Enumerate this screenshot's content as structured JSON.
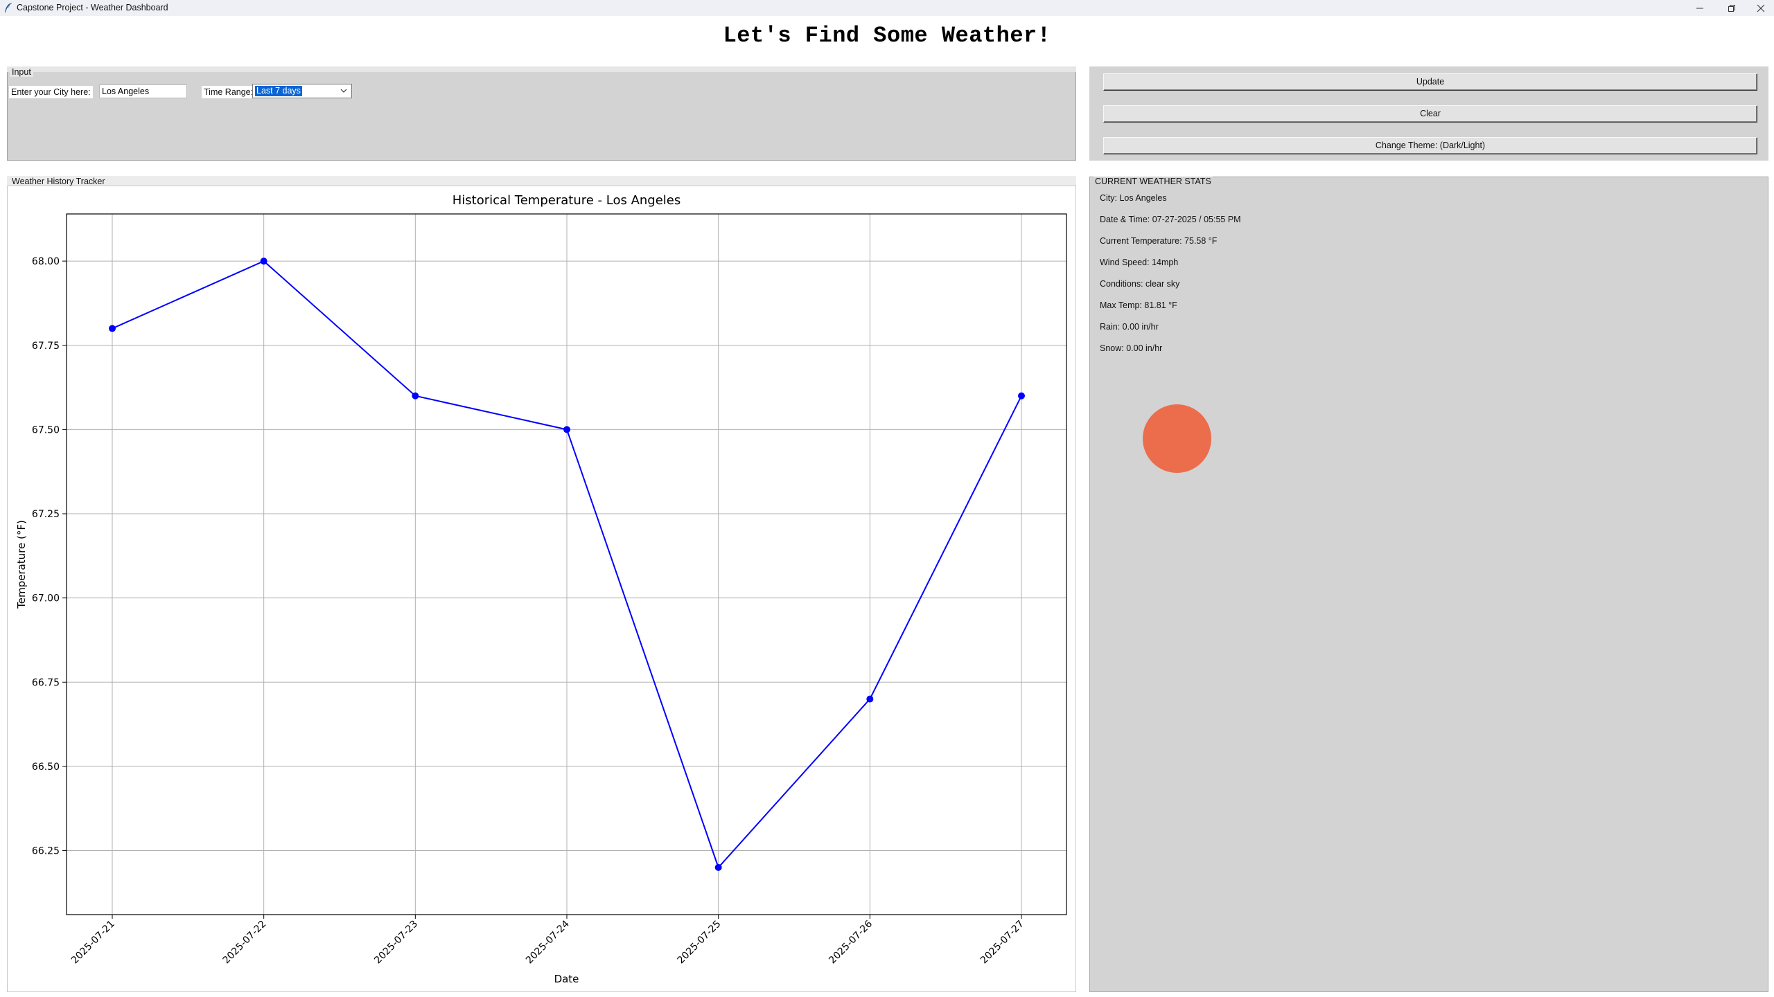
{
  "window": {
    "title": "Capstone Project - Weather Dashboard",
    "controls": [
      "minimize",
      "restore",
      "close"
    ]
  },
  "heading": "Let's Find Some Weather!",
  "input_panel": {
    "label": "Input",
    "city_label": "Enter your City here:",
    "city_value": "Los Angeles",
    "range_label": "Time Range:",
    "range_value": "Last 7 days"
  },
  "buttons": {
    "update": "Update",
    "clear": "Clear",
    "theme": "Change Theme: (Dark/Light)"
  },
  "history_panel": {
    "label": "Weather History Tracker"
  },
  "stats_panel": {
    "label": "CURRENT WEATHER STATS",
    "city": "City: Los Angeles",
    "datetime": "Date & Time: 07-27-2025 / 05:55 PM",
    "current_temp": "Current Temperature: 75.58 °F",
    "wind": "Wind Speed: 14mph",
    "conditions": "Conditions: clear sky",
    "max_temp": "Max Temp: 81.81 °F",
    "rain": "Rain: 0.00 in/hr",
    "snow": "Snow: 0.00 in/hr",
    "weather_icon": "sun-icon",
    "icon_color": "#ec6d4c"
  },
  "chart_data": {
    "type": "line",
    "title": "Historical Temperature - Los Angeles",
    "xlabel": "Date",
    "ylabel": "Temperature (°F)",
    "categories": [
      "2025-07-21",
      "2025-07-22",
      "2025-07-23",
      "2025-07-24",
      "2025-07-25",
      "2025-07-26",
      "2025-07-27"
    ],
    "values": [
      67.8,
      68.0,
      67.6,
      67.5,
      66.2,
      66.7,
      67.6
    ],
    "yticks": [
      "66.25",
      "66.50",
      "66.75",
      "67.00",
      "67.25",
      "67.50",
      "67.75",
      "68.00"
    ],
    "ylim": [
      66.06,
      68.14
    ],
    "grid": true,
    "line_color": "#0000ff"
  }
}
